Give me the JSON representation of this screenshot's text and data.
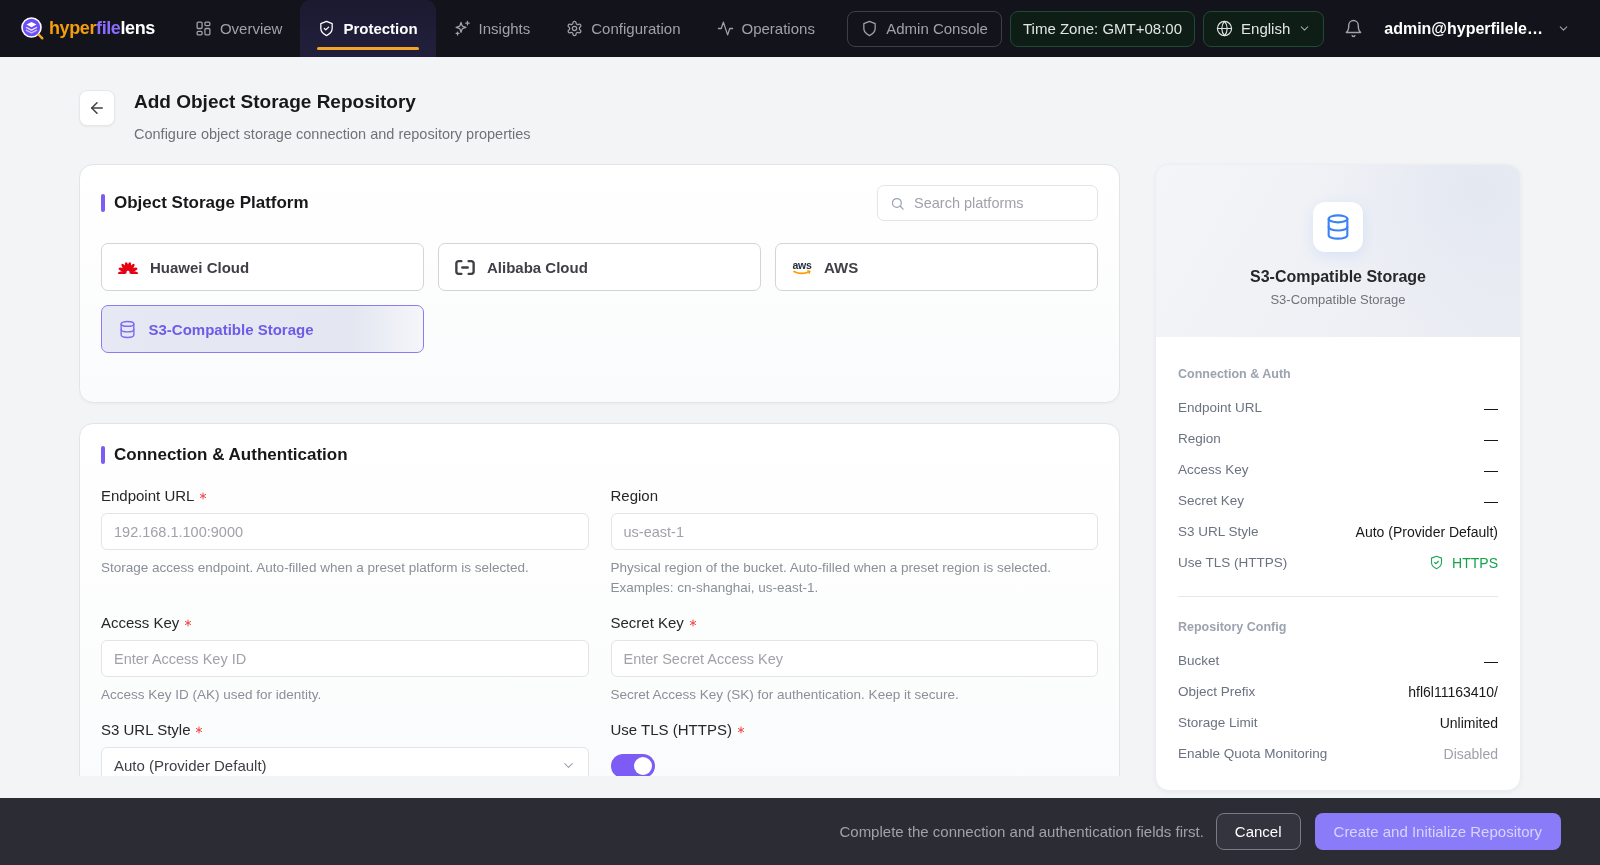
{
  "topbar": {
    "logo": {
      "parts": [
        "hyper",
        "file",
        "lens"
      ]
    },
    "nav": [
      {
        "label": "Overview",
        "selected": false
      },
      {
        "label": "Protection",
        "selected": true
      },
      {
        "label": "Insights",
        "selected": false
      },
      {
        "label": "Configuration",
        "selected": false
      },
      {
        "label": "Operations",
        "selected": false
      }
    ],
    "admin_console": "Admin Console",
    "time_zone": "Time Zone: GMT+08:00",
    "language": "English",
    "user": "admin@hyperfilele…"
  },
  "page_header": {
    "title": "Add Object Storage Repository",
    "subtitle": "Configure object storage connection and repository properties"
  },
  "platforms": {
    "title": "Object Storage Platform",
    "search": {
      "placeholder": "Search platforms"
    },
    "items": [
      {
        "name": "Huawei Cloud",
        "selected": false
      },
      {
        "name": "Alibaba Cloud",
        "selected": false
      },
      {
        "name": "AWS",
        "logo_text": "aws",
        "selected": false
      },
      {
        "name": "S3-Compatible Storage",
        "selected": true
      }
    ]
  },
  "connection": {
    "title": "Connection & Authentication",
    "fields": [
      {
        "kind": "input",
        "label": "Endpoint URL",
        "required": true,
        "placeholder": "192.168.1.100:9000",
        "help": "Storage access endpoint. Auto-filled when a preset platform is selected."
      },
      {
        "kind": "input",
        "label": "Region",
        "required": false,
        "placeholder": "us-east-1",
        "help": "Physical region of the bucket. Auto-filled when a preset region is selected. Examples: cn-shanghai, us-east-1."
      },
      {
        "kind": "input",
        "label": "Access Key",
        "required": true,
        "placeholder": "Enter Access Key ID",
        "help": "Access Key ID (AK) used for identity."
      },
      {
        "kind": "input",
        "label": "Secret Key",
        "required": true,
        "placeholder": "Enter Secret Access Key",
        "help": "Secret Access Key (SK) for authentication. Keep it secure."
      },
      {
        "kind": "select",
        "label": "S3 URL Style",
        "required": true,
        "value": "Auto (Provider Default)"
      },
      {
        "kind": "toggle",
        "label": "Use TLS (HTTPS)",
        "required": true,
        "on": true
      }
    ]
  },
  "summary": {
    "title": "S3-Compatible Storage",
    "subtitle": "S3-Compatible Storage",
    "groups": [
      {
        "title": "Connection & Auth",
        "rows": [
          {
            "label": "Endpoint URL",
            "value": "—",
            "kind": "plain"
          },
          {
            "label": "Region",
            "value": "—",
            "kind": "plain"
          },
          {
            "label": "Access Key",
            "value": "—",
            "kind": "plain"
          },
          {
            "label": "Secret Key",
            "value": "—",
            "kind": "plain"
          },
          {
            "label": "S3 URL Style",
            "value": "Auto (Provider Default)",
            "kind": "plain"
          },
          {
            "label": "Use TLS (HTTPS)",
            "value": "HTTPS",
            "kind": "secure"
          }
        ]
      },
      {
        "title": "Repository Config",
        "rows": [
          {
            "label": "Bucket",
            "value": "—",
            "kind": "plain"
          },
          {
            "label": "Object Prefix",
            "value": "hfl6l11163410/",
            "kind": "plain"
          },
          {
            "label": "Storage Limit",
            "value": "Unlimited",
            "kind": "plain"
          },
          {
            "label": "Enable Quota Monitoring",
            "value": "Disabled",
            "kind": "muted"
          }
        ]
      }
    ]
  },
  "footer": {
    "message": "Complete the connection and authentication fields first.",
    "cancel": "Cancel",
    "submit": {
      "label": "Create and Initialize Repository",
      "disabled": true
    }
  }
}
